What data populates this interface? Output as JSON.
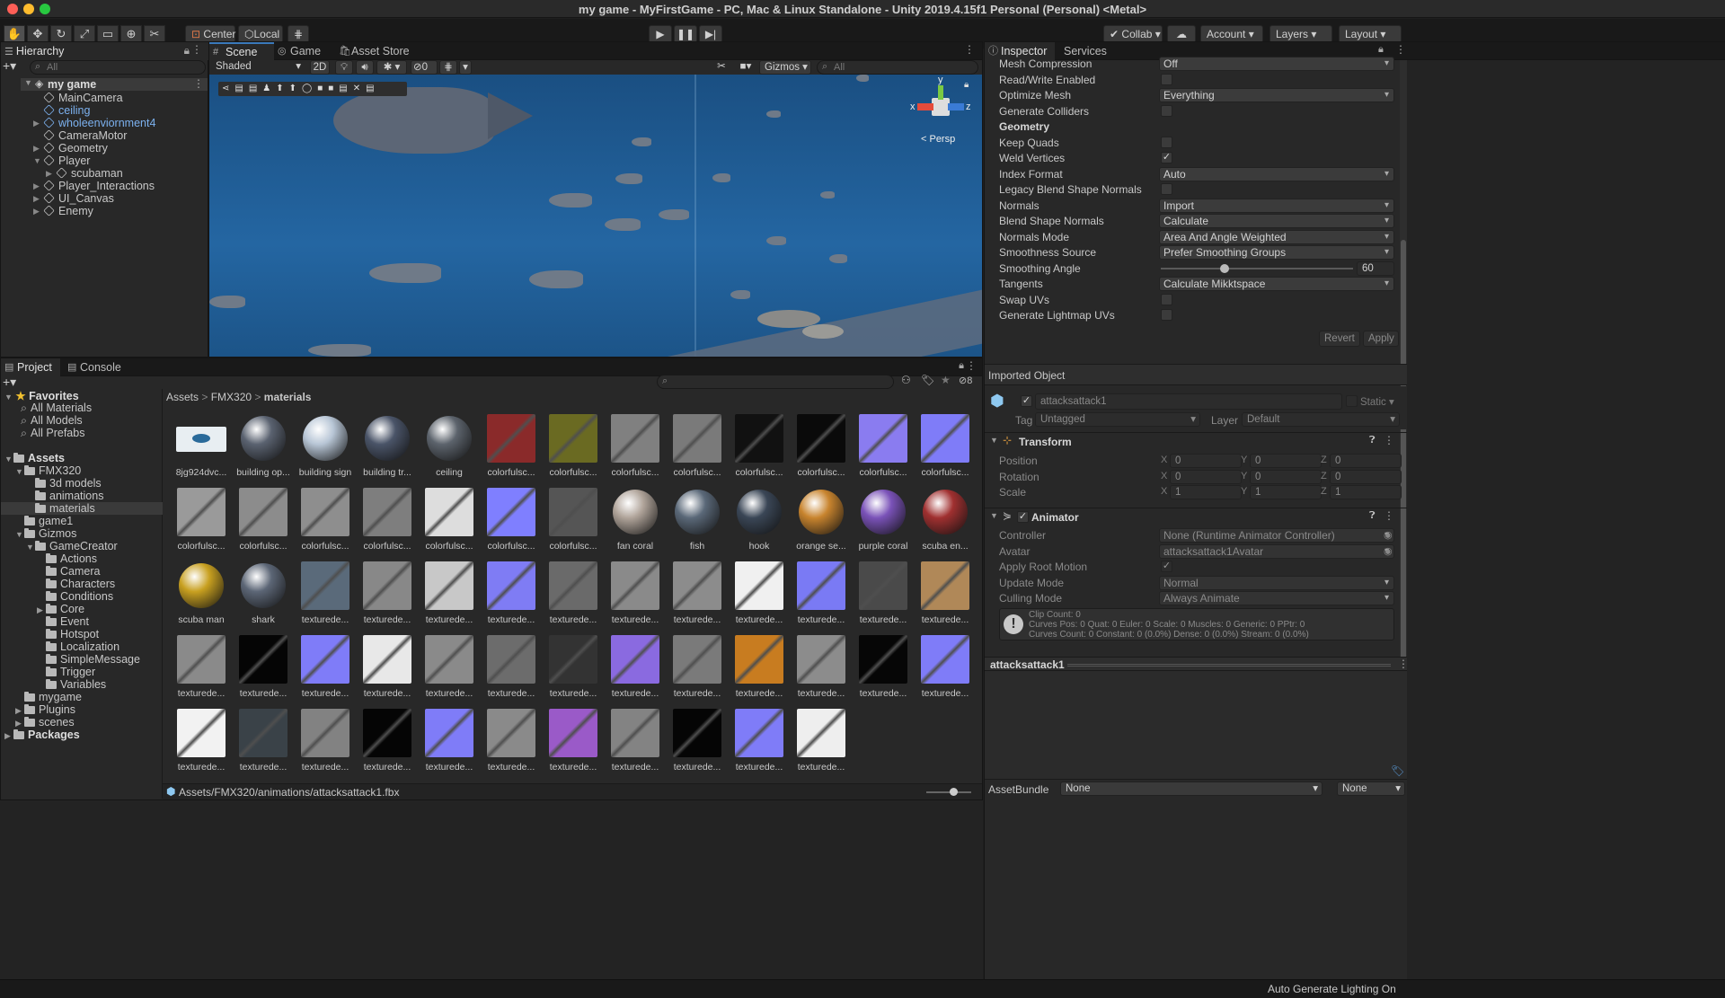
{
  "window": {
    "title": "my game - MyFirstGame - PC, Mac & Linux Standalone - Unity 2019.4.15f1 Personal (Personal) <Metal>"
  },
  "toolbar": {
    "tools": [
      "hand-icon",
      "move-icon",
      "rotate-icon",
      "scale-icon",
      "rect-icon",
      "transform-icon",
      "custom-tool-icon"
    ],
    "pivot": "Center",
    "space": "Local",
    "collab": "Collab",
    "account": "Account",
    "layers": "Layers",
    "layout": "Layout"
  },
  "hierarchy": {
    "tab": "Hierarchy",
    "search_placeholder": "All",
    "scene": "my game",
    "items": [
      {
        "label": "MainCamera",
        "blue": false,
        "arrow": ""
      },
      {
        "label": "ceiling",
        "blue": true,
        "arrow": ""
      },
      {
        "label": "wholeenviornment4",
        "blue": true,
        "arrow": "▶"
      },
      {
        "label": "CameraMotor",
        "blue": false,
        "arrow": ""
      },
      {
        "label": "Geometry",
        "blue": false,
        "arrow": "▶"
      },
      {
        "label": "Player",
        "blue": false,
        "arrow": "▼"
      },
      {
        "label": "scubaman",
        "blue": false,
        "arrow": "▶",
        "indent": true
      },
      {
        "label": "Player_Interactions",
        "blue": false,
        "arrow": "▶"
      },
      {
        "label": "UI_Canvas",
        "blue": false,
        "arrow": "▶"
      },
      {
        "label": "Enemy",
        "blue": false,
        "arrow": "▶"
      }
    ]
  },
  "scene_view": {
    "tabs": [
      "Scene",
      "Game",
      "Asset Store"
    ],
    "shading": "Shaded",
    "mode_2d": "2D",
    "hidden_count": "0",
    "gizmos": "Gizmos",
    "search_placeholder": "All",
    "persp": "< Persp",
    "axes": {
      "x": "x",
      "y": "y",
      "z": "z"
    }
  },
  "project": {
    "tabs": [
      "Project",
      "Console"
    ],
    "hidden_count": "8",
    "breadcrumb": [
      "Assets",
      "FMX320",
      "materials"
    ],
    "favorites_label": "Favorites",
    "favorites": [
      "All Materials",
      "All Models",
      "All Prefabs"
    ],
    "tree": [
      {
        "label": "Assets",
        "level": 0,
        "arrow": "▼",
        "bold": true
      },
      {
        "label": "FMX320",
        "level": 1,
        "arrow": "▼"
      },
      {
        "label": "3d models",
        "level": 2,
        "arrow": ""
      },
      {
        "label": "animations",
        "level": 2,
        "arrow": ""
      },
      {
        "label": "materials",
        "level": 2,
        "arrow": "",
        "selected": true
      },
      {
        "label": "game1",
        "level": 1,
        "arrow": ""
      },
      {
        "label": "Gizmos",
        "level": 1,
        "arrow": "▼"
      },
      {
        "label": "GameCreator",
        "level": 2,
        "arrow": "▼"
      },
      {
        "label": "Actions",
        "level": 3,
        "arrow": ""
      },
      {
        "label": "Camera",
        "level": 3,
        "arrow": ""
      },
      {
        "label": "Characters",
        "level": 3,
        "arrow": ""
      },
      {
        "label": "Conditions",
        "level": 3,
        "arrow": ""
      },
      {
        "label": "Core",
        "level": 3,
        "arrow": "▶"
      },
      {
        "label": "Event",
        "level": 3,
        "arrow": ""
      },
      {
        "label": "Hotspot",
        "level": 3,
        "arrow": ""
      },
      {
        "label": "Localization",
        "level": 3,
        "arrow": ""
      },
      {
        "label": "SimpleMessage",
        "level": 3,
        "arrow": ""
      },
      {
        "label": "Trigger",
        "level": 3,
        "arrow": ""
      },
      {
        "label": "Variables",
        "level": 3,
        "arrow": ""
      },
      {
        "label": "mygame",
        "level": 1,
        "arrow": ""
      },
      {
        "label": "Plugins",
        "level": 1,
        "arrow": "▶"
      },
      {
        "label": "scenes",
        "level": 1,
        "arrow": "▶"
      },
      {
        "label": "Packages",
        "level": 0,
        "arrow": "▶",
        "bold": true
      }
    ],
    "assets": [
      {
        "label": "8jg924dvc...",
        "c": "#e8eef2",
        "k": "img"
      },
      {
        "label": "building op...",
        "c": "#5a6270",
        "k": "ball"
      },
      {
        "label": "building sign",
        "c": "#b8c6d6",
        "k": "ball"
      },
      {
        "label": "building tr...",
        "c": "#4a5468",
        "k": "ball"
      },
      {
        "label": "ceiling",
        "c": "#5c636c",
        "k": "ball"
      },
      {
        "label": "colorfulsc...",
        "c": "#8a2a2a",
        "k": "tex"
      },
      {
        "label": "colorfulsc...",
        "c": "#6a6a22",
        "k": "tex"
      },
      {
        "label": "colorfulsc...",
        "c": "#808080",
        "k": "tex"
      },
      {
        "label": "colorfulsc...",
        "c": "#7a7a7a",
        "k": "tex"
      },
      {
        "label": "colorfulsc...",
        "c": "#111111",
        "k": "tex"
      },
      {
        "label": "colorfulsc...",
        "c": "#0a0a0a",
        "k": "tex"
      },
      {
        "label": "colorfulsc...",
        "c": "#8a7cf0",
        "k": "tex"
      },
      {
        "label": "colorfulsc...",
        "c": "#7f7cf8",
        "k": "tex"
      },
      {
        "label": "colorfulsc...",
        "c": "#9a9a9a",
        "k": "tex"
      },
      {
        "label": "colorfulsc...",
        "c": "#8c8c8c",
        "k": "tex"
      },
      {
        "label": "colorfulsc...",
        "c": "#8e8e8e",
        "k": "tex"
      },
      {
        "label": "colorfulsc...",
        "c": "#7e7e7e",
        "k": "tex"
      },
      {
        "label": "colorfulsc...",
        "c": "#dddddd",
        "k": "tex"
      },
      {
        "label": "colorfulsc...",
        "c": "#7f7fff",
        "k": "tex"
      },
      {
        "label": "colorfulsc...",
        "c": "#555555",
        "k": "tex"
      },
      {
        "label": "fan coral",
        "c": "#b0a49a",
        "k": "ball"
      },
      {
        "label": "fish",
        "c": "#5a6878",
        "k": "ball"
      },
      {
        "label": "hook",
        "c": "#3a4656",
        "k": "ball"
      },
      {
        "label": "orange se...",
        "c": "#c8842e",
        "k": "ball"
      },
      {
        "label": "purple coral",
        "c": "#7a52b8",
        "k": "ball"
      },
      {
        "label": "scuba en...",
        "c": "#a03030",
        "k": "ball"
      },
      {
        "label": "scuba man",
        "c": "#c8a020",
        "k": "ball"
      },
      {
        "label": "shark",
        "c": "#5c6676",
        "k": "ball"
      },
      {
        "label": "texturede...",
        "c": "#5a6a7a",
        "k": "tex"
      },
      {
        "label": "texturede...",
        "c": "#888888",
        "k": "tex"
      },
      {
        "label": "texturede...",
        "c": "#c8c8c8",
        "k": "tex"
      },
      {
        "label": "texturede...",
        "c": "#7f7cf4",
        "k": "tex"
      },
      {
        "label": "texturede...",
        "c": "#6a6a6a",
        "k": "tex"
      },
      {
        "label": "texturede...",
        "c": "#8a8a8a",
        "k": "tex"
      },
      {
        "label": "texturede...",
        "c": "#8c8c8c",
        "k": "tex"
      },
      {
        "label": "texturede...",
        "c": "#f0f0f0",
        "k": "tex"
      },
      {
        "label": "texturede...",
        "c": "#7a7af4",
        "k": "tex"
      },
      {
        "label": "texturede...",
        "c": "#4a4a4a",
        "k": "tex"
      },
      {
        "label": "texturede...",
        "c": "#b08858",
        "k": "tex"
      },
      {
        "label": "texturede...",
        "c": "#8a8a8a",
        "k": "tex"
      },
      {
        "label": "texturede...",
        "c": "#050505",
        "k": "tex"
      },
      {
        "label": "texturede...",
        "c": "#7f7cf8",
        "k": "tex"
      },
      {
        "label": "texturede...",
        "c": "#e8e8e8",
        "k": "tex"
      },
      {
        "label": "texturede...",
        "c": "#8a8a8a",
        "k": "tex"
      },
      {
        "label": "texturede...",
        "c": "#6c6c6c",
        "k": "tex"
      },
      {
        "label": "texturede...",
        "c": "#333333",
        "k": "tex"
      },
      {
        "label": "texturede...",
        "c": "#8a6ae0",
        "k": "tex"
      },
      {
        "label": "texturede...",
        "c": "#7a7a7a",
        "k": "tex"
      },
      {
        "label": "texturede...",
        "c": "#c87c20",
        "k": "tex"
      },
      {
        "label": "texturede...",
        "c": "#8c8c8c",
        "k": "tex"
      },
      {
        "label": "texturede...",
        "c": "#060606",
        "k": "tex"
      },
      {
        "label": "texturede...",
        "c": "#7f7cf8",
        "k": "tex"
      },
      {
        "label": "texturede...",
        "c": "#f2f2f2",
        "k": "tex"
      },
      {
        "label": "texturede...",
        "c": "#3a4248",
        "k": "tex"
      },
      {
        "label": "texturede...",
        "c": "#828282",
        "k": "tex"
      },
      {
        "label": "texturede...",
        "c": "#050505",
        "k": "tex"
      },
      {
        "label": "texturede...",
        "c": "#7f7cf8",
        "k": "tex"
      },
      {
        "label": "texturede...",
        "c": "#8a8a8a",
        "k": "tex"
      },
      {
        "label": "texturede...",
        "c": "#9a5ac8",
        "k": "tex"
      },
      {
        "label": "texturede...",
        "c": "#838383",
        "k": "tex"
      },
      {
        "label": "texturede...",
        "c": "#050505",
        "k": "tex"
      },
      {
        "label": "texturede...",
        "c": "#7f7cf8",
        "k": "tex"
      },
      {
        "label": "texturede...",
        "c": "#eeeeee",
        "k": "tex"
      }
    ],
    "status_path": "Assets/FMX320/animations/attacksattack1.fbx"
  },
  "inspector": {
    "tabs": [
      "Inspector",
      "Services"
    ],
    "rows": [
      {
        "label": "Mesh Compression",
        "type": "dd",
        "value": "Off"
      },
      {
        "label": "Read/Write Enabled",
        "type": "chk",
        "value": ""
      },
      {
        "label": "Optimize Mesh",
        "type": "dd",
        "value": "Everything"
      },
      {
        "label": "Generate Colliders",
        "type": "chk",
        "value": ""
      },
      {
        "label": "Geometry",
        "type": "header",
        "value": ""
      },
      {
        "label": "Keep Quads",
        "type": "chk",
        "value": ""
      },
      {
        "label": "Weld Vertices",
        "type": "chk",
        "value": "✓"
      },
      {
        "label": "Index Format",
        "type": "dd",
        "value": "Auto"
      },
      {
        "label": "Legacy Blend Shape Normals",
        "type": "chk",
        "value": ""
      },
      {
        "label": "Normals",
        "type": "dd",
        "value": "Import"
      },
      {
        "label": "Blend Shape Normals",
        "type": "dd",
        "value": "Calculate"
      },
      {
        "label": "Normals Mode",
        "type": "dd",
        "value": "Area And Angle Weighted"
      },
      {
        "label": "Smoothness Source",
        "type": "dd",
        "value": "Prefer Smoothing Groups"
      },
      {
        "label": "Smoothing Angle",
        "type": "slider",
        "value": "60",
        "fraction": 0.333
      },
      {
        "label": "Tangents",
        "type": "dd",
        "value": "Calculate Mikktspace"
      },
      {
        "label": "Swap UVs",
        "type": "chk",
        "value": ""
      },
      {
        "label": "Generate Lightmap UVs",
        "type": "chk",
        "value": ""
      }
    ],
    "revert": "Revert",
    "apply": "Apply",
    "imported_object": "Imported Object",
    "object_name": "attacksattack1",
    "static": "Static",
    "tag_label": "Tag",
    "tag_value": "Untagged",
    "layer_label": "Layer",
    "layer_value": "Default",
    "transform": {
      "title": "Transform",
      "rows": [
        {
          "label": "Position",
          "x": "0",
          "y": "0",
          "z": "0"
        },
        {
          "label": "Rotation",
          "x": "0",
          "y": "0",
          "z": "0"
        },
        {
          "label": "Scale",
          "x": "1",
          "y": "1",
          "z": "1"
        }
      ],
      "axis": {
        "x": "X",
        "y": "Y",
        "z": "Z"
      }
    },
    "animator": {
      "title": "Animator",
      "rows": [
        {
          "label": "Controller",
          "type": "obj",
          "value": "None (Runtime Animator Controller)"
        },
        {
          "label": "Avatar",
          "type": "obj",
          "value": "attacksattack1Avatar"
        },
        {
          "label": "Apply Root Motion",
          "type": "chk",
          "value": "✓"
        },
        {
          "label": "Update Mode",
          "type": "dd",
          "value": "Normal"
        },
        {
          "label": "Culling Mode",
          "type": "dd",
          "value": "Always Animate"
        }
      ],
      "info": [
        "Clip Count: 0",
        "Curves Pos: 0 Quat: 0 Euler: 0 Scale: 0 Muscles: 0 Generic: 0 PPtr: 0",
        "Curves Count: 0 Constant: 0 (0.0%) Dense: 0 (0.0%) Stream: 0 (0.0%)"
      ]
    },
    "preview_name": "attacksattack1",
    "assetbundle_label": "AssetBundle",
    "assetbundle_value": "None",
    "assetbundle_variant": "None"
  },
  "statusbar": {
    "text": "Auto Generate Lighting On"
  },
  "colors": {
    "accent": "#3a79bb",
    "water": "#1f5e95",
    "selection": "#2c5d87",
    "link": "#7cb1ef"
  }
}
